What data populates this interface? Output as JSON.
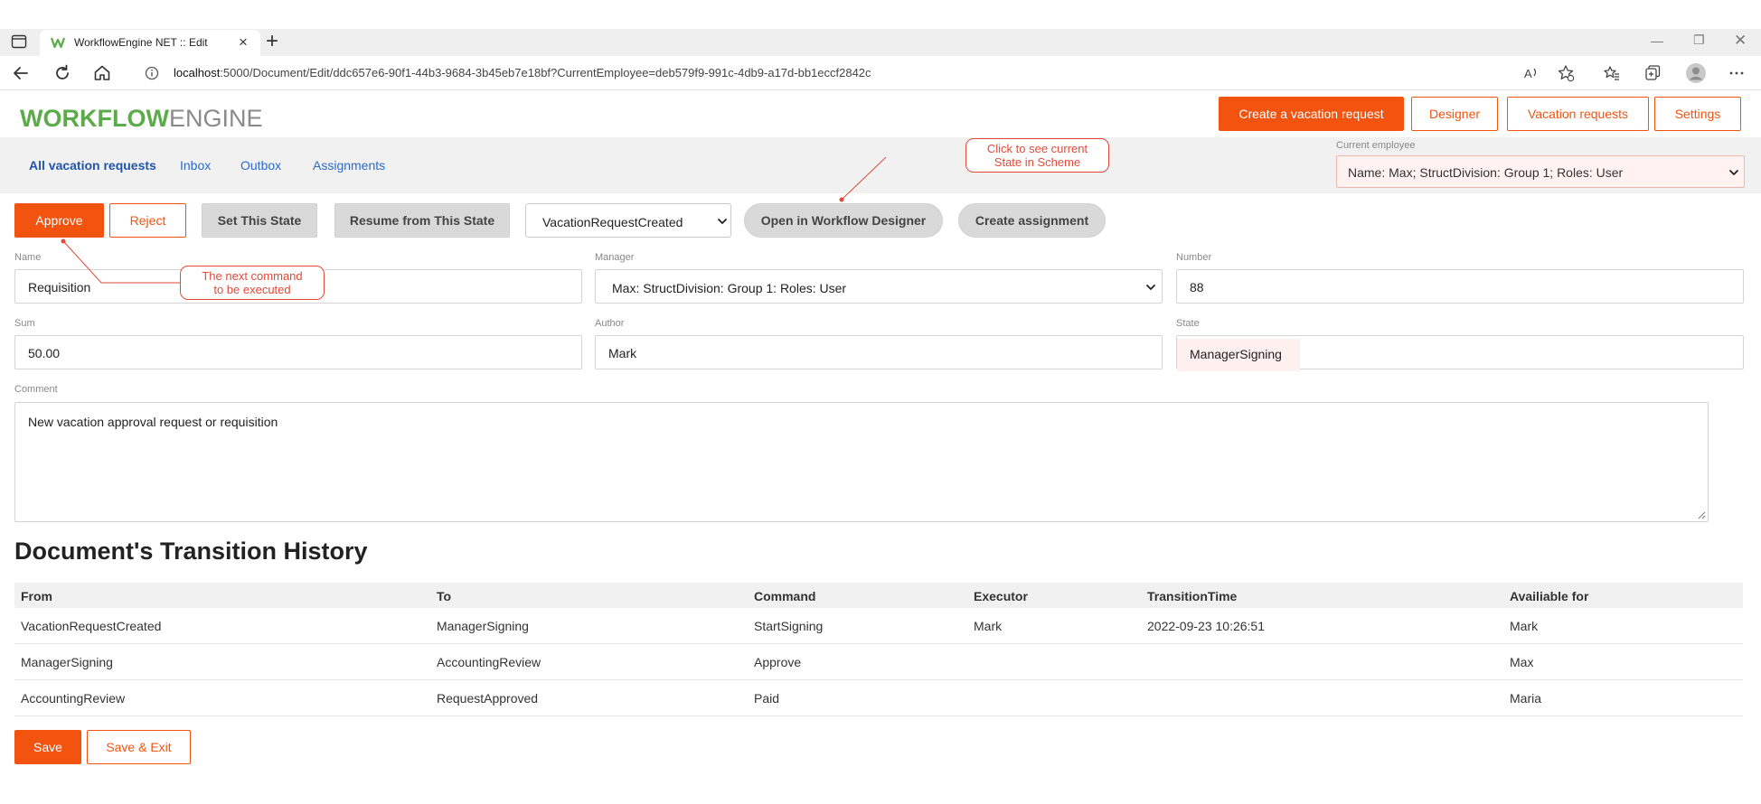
{
  "browser": {
    "tab_title": "WorkflowEngine NET :: Edit",
    "url_host": "localhost",
    "url_rest": ":5000/Document/Edit/ddc657e6-90f1-44b3-9684-3b45eb7e18bf?CurrentEmployee=deb579f9-991c-4db9-a17d-bb1eccf2842c"
  },
  "header": {
    "logo_bold": "WORKFLOW",
    "logo_light": "ENGINE",
    "buttons": [
      "Create a vacation request",
      "Designer",
      "Vacation requests",
      "Settings"
    ]
  },
  "subnav": {
    "links": [
      "All vacation requests",
      "Inbox",
      "Outbox",
      "Assignments"
    ],
    "current_employee_label": "Current employee",
    "current_employee_value": "Name: Max; StructDivision: Group 1; Roles: User"
  },
  "commands": {
    "approve": "Approve",
    "reject": "Reject",
    "set_state": "Set This State",
    "resume": "Resume from This State",
    "state_select": "VacationRequestCreated",
    "open_designer": "Open in Workflow Designer",
    "create_assignment": "Create assignment"
  },
  "form": {
    "name_label": "Name",
    "name_value": "Requisition",
    "manager_label": "Manager",
    "manager_value": "Max: StructDivision: Group 1: Roles: User",
    "number_label": "Number",
    "number_value": "88",
    "sum_label": "Sum",
    "sum_value": "50.00",
    "author_label": "Author",
    "author_value": "Mark",
    "state_label": "State",
    "state_value": "ManagerSigning",
    "comment_label": "Comment",
    "comment_value": "New vacation approval request or requisition"
  },
  "callouts": {
    "scheme_line1": "Click to see current",
    "scheme_line2": "State in Scheme",
    "next_line1": "The next command",
    "next_line2": "to be executed"
  },
  "history": {
    "title": "Document's Transition History",
    "columns": [
      "From",
      "To",
      "Command",
      "Executor",
      "TransitionTime",
      "Availiable for"
    ],
    "rows": [
      [
        "VacationRequestCreated",
        "ManagerSigning",
        "StartSigning",
        "Mark",
        "2022-09-23 10:26:51",
        "Mark"
      ],
      [
        "ManagerSigning",
        "AccountingReview",
        "Approve",
        "",
        "",
        "Max"
      ],
      [
        "AccountingReview",
        "RequestApproved",
        "Paid",
        "",
        "",
        "Maria"
      ]
    ]
  },
  "footer": {
    "save": "Save",
    "save_exit": "Save & Exit"
  },
  "colors": {
    "accent": "#f25410",
    "logo_green": "#5cab4a",
    "link_blue": "#2c6ac8",
    "callout_red": "#e04b3a"
  },
  "icons": [
    "sidebar-icon",
    "workflow-favicon",
    "close-icon",
    "plus-icon",
    "minimize-icon",
    "restore-icon",
    "window-close-icon",
    "back-icon",
    "refresh-icon",
    "home-icon",
    "info-icon",
    "read-aloud-icon",
    "favorite-add-icon",
    "favorites-icon",
    "collections-icon",
    "profile-icon",
    "more-icon",
    "chevron-down-icon"
  ]
}
